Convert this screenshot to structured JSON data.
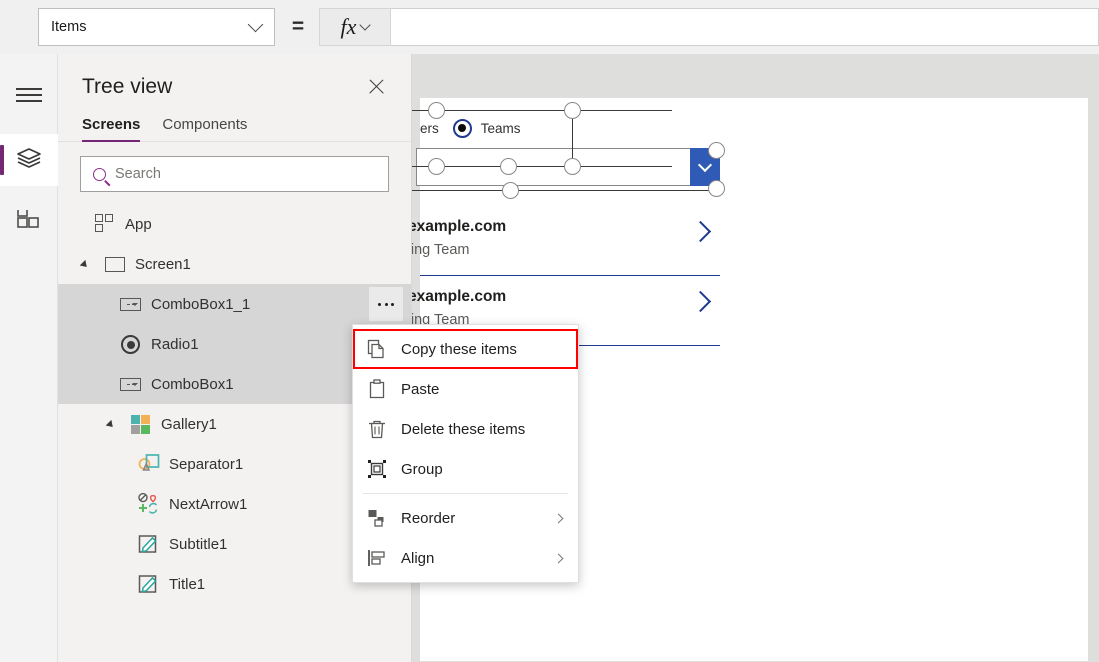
{
  "formula_bar": {
    "property_value": "Items",
    "equals": "=",
    "fx_label": "fx",
    "formula_value": ""
  },
  "rail": {
    "items": [
      {
        "name": "menu-icon",
        "label": "Menu"
      },
      {
        "name": "tree-view-icon",
        "label": "Tree view"
      },
      {
        "name": "insert-icon",
        "label": "Insert"
      }
    ]
  },
  "tree_view": {
    "title": "Tree view",
    "close_label": "Close",
    "tabs": [
      {
        "label": "Screens",
        "active": true
      },
      {
        "label": "Components",
        "active": false
      }
    ],
    "search": {
      "placeholder": "Search",
      "value": ""
    },
    "nodes": [
      {
        "label": "App",
        "icon": "app-icon",
        "indent": 0,
        "selected": false,
        "expandable": false
      },
      {
        "label": "Screen1",
        "icon": "screen-icon",
        "indent": 0,
        "selected": false,
        "expandable": true
      },
      {
        "label": "ComboBox1_1",
        "icon": "combobox-icon",
        "indent": 1,
        "selected": true,
        "expandable": false
      },
      {
        "label": "Radio1",
        "icon": "radio-icon",
        "indent": 1,
        "selected": true,
        "expandable": false
      },
      {
        "label": "ComboBox1",
        "icon": "combobox-icon",
        "indent": 1,
        "selected": true,
        "expandable": false
      },
      {
        "label": "Gallery1",
        "icon": "gallery-icon",
        "indent": 1,
        "selected": false,
        "expandable": true
      },
      {
        "label": "Separator1",
        "icon": "separator-icon",
        "indent": 2,
        "selected": false,
        "expandable": false
      },
      {
        "label": "NextArrow1",
        "icon": "nextarrow-icon",
        "indent": 2,
        "selected": false,
        "expandable": false
      },
      {
        "label": "Subtitle1",
        "icon": "label-icon",
        "indent": 2,
        "selected": false,
        "expandable": false
      },
      {
        "label": "Title1",
        "icon": "label-icon",
        "indent": 2,
        "selected": false,
        "expandable": false
      }
    ],
    "overflow_label": "More options"
  },
  "context_menu": {
    "highlight_color": "#ff0000",
    "items": [
      {
        "label": "Copy these items",
        "icon": "copy-icon",
        "highlighted": true,
        "submenu": false
      },
      {
        "label": "Paste",
        "icon": "paste-icon",
        "highlighted": false,
        "submenu": false
      },
      {
        "label": "Delete these items",
        "icon": "trash-icon",
        "highlighted": false,
        "submenu": false
      },
      {
        "label": "Group",
        "icon": "group-icon",
        "highlighted": false,
        "submenu": false
      },
      {
        "label": "Reorder",
        "icon": "reorder-icon",
        "highlighted": false,
        "submenu": true
      },
      {
        "label": "Align",
        "icon": "align-icon",
        "highlighted": false,
        "submenu": true
      }
    ]
  },
  "canvas": {
    "radio_left_clipped": "ers",
    "radio_option": "Teams",
    "gallery_items": [
      {
        "title": "example.com",
        "subtitle": "ering Team"
      },
      {
        "title": "example.com",
        "subtitle": "ering Team"
      }
    ]
  },
  "colors": {
    "accent_purple": "#742774",
    "selection_blue": "#2f5bb7",
    "gallery_border": "#203a8f",
    "highlight_red": "#ff0000",
    "panel_bg": "#f3f2f1",
    "canvas_bg": "#dededd"
  }
}
